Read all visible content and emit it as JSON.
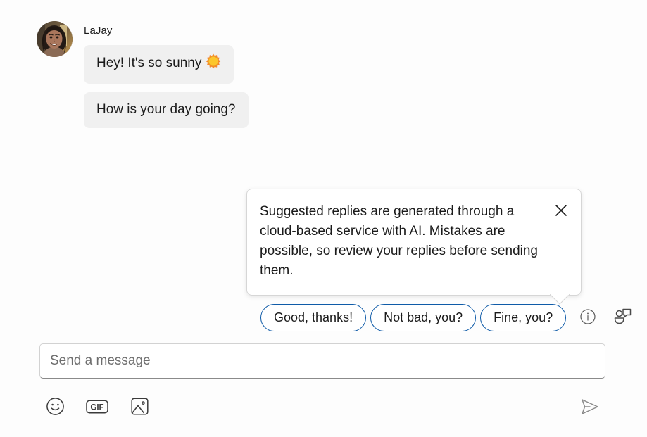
{
  "conversation": {
    "sender_name": "LaJay",
    "avatar": {
      "icon": "user-avatar-photo",
      "alt": "LaJay profile photo"
    },
    "messages": [
      {
        "text": "Hey! It's so sunny",
        "emoji": "sun-emoji",
        "emoji_char": "☀️"
      },
      {
        "text": "How is your day going?",
        "emoji": null,
        "emoji_char": ""
      }
    ]
  },
  "callout": {
    "body": "Suggested replies are generated through a cloud-based service with AI. Mistakes are possible, so review your replies before sending them.",
    "close_icon": "close-icon",
    "close_label": "Close"
  },
  "suggestions": {
    "chips": [
      {
        "label": "Good, thanks!"
      },
      {
        "label": "Not bad, you?"
      },
      {
        "label": "Fine, you?"
      }
    ],
    "info_icon": "info-icon",
    "info_label": "Info about suggested replies",
    "smart_reply_icon": "suggested-replies-icon",
    "smart_reply_label": "Suggested replies"
  },
  "composer": {
    "placeholder": "Send a message",
    "value": "",
    "tools": [
      {
        "icon": "emoji-icon",
        "label": "Emoji"
      },
      {
        "icon": "gif-icon",
        "label": "GIF",
        "text": "GIF"
      },
      {
        "icon": "image-icon",
        "label": "Image"
      }
    ],
    "send_icon": "send-icon",
    "send_label": "Send"
  },
  "colors": {
    "accent_blue": "#0f5ba8",
    "bubble_grey": "#f0f0f0",
    "text_primary": "#1b1b1b",
    "icon_grey": "#3b3b3b",
    "send_grey": "#8a8a8a",
    "border_grey": "#d6d6d6"
  }
}
